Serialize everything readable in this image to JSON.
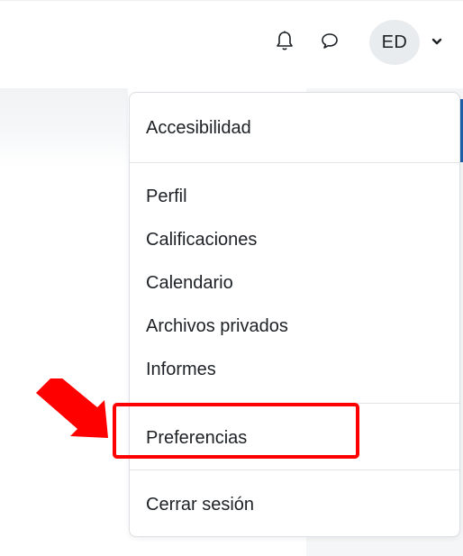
{
  "navbar": {
    "icons": [
      "bell-icon",
      "chat-bubble-icon",
      "chevron-down-icon"
    ],
    "avatar_initials": "ED"
  },
  "menu": {
    "top_items": [
      "Accesibilidad"
    ],
    "profile_items": [
      "Perfil",
      "Calificaciones",
      "Calendario",
      "Archivos privados",
      "Informes"
    ],
    "preferences_label": "Preferencias",
    "logout_label": "Cerrar sesión"
  },
  "annotation": {
    "highlight_color": "#ff0000",
    "arrow_color": "#ff0000",
    "highlighted_item": "Preferencias"
  },
  "colors": {
    "text": "#1d2125",
    "avatar_bg": "#e9ecef",
    "accent": "#1f5fa8"
  }
}
